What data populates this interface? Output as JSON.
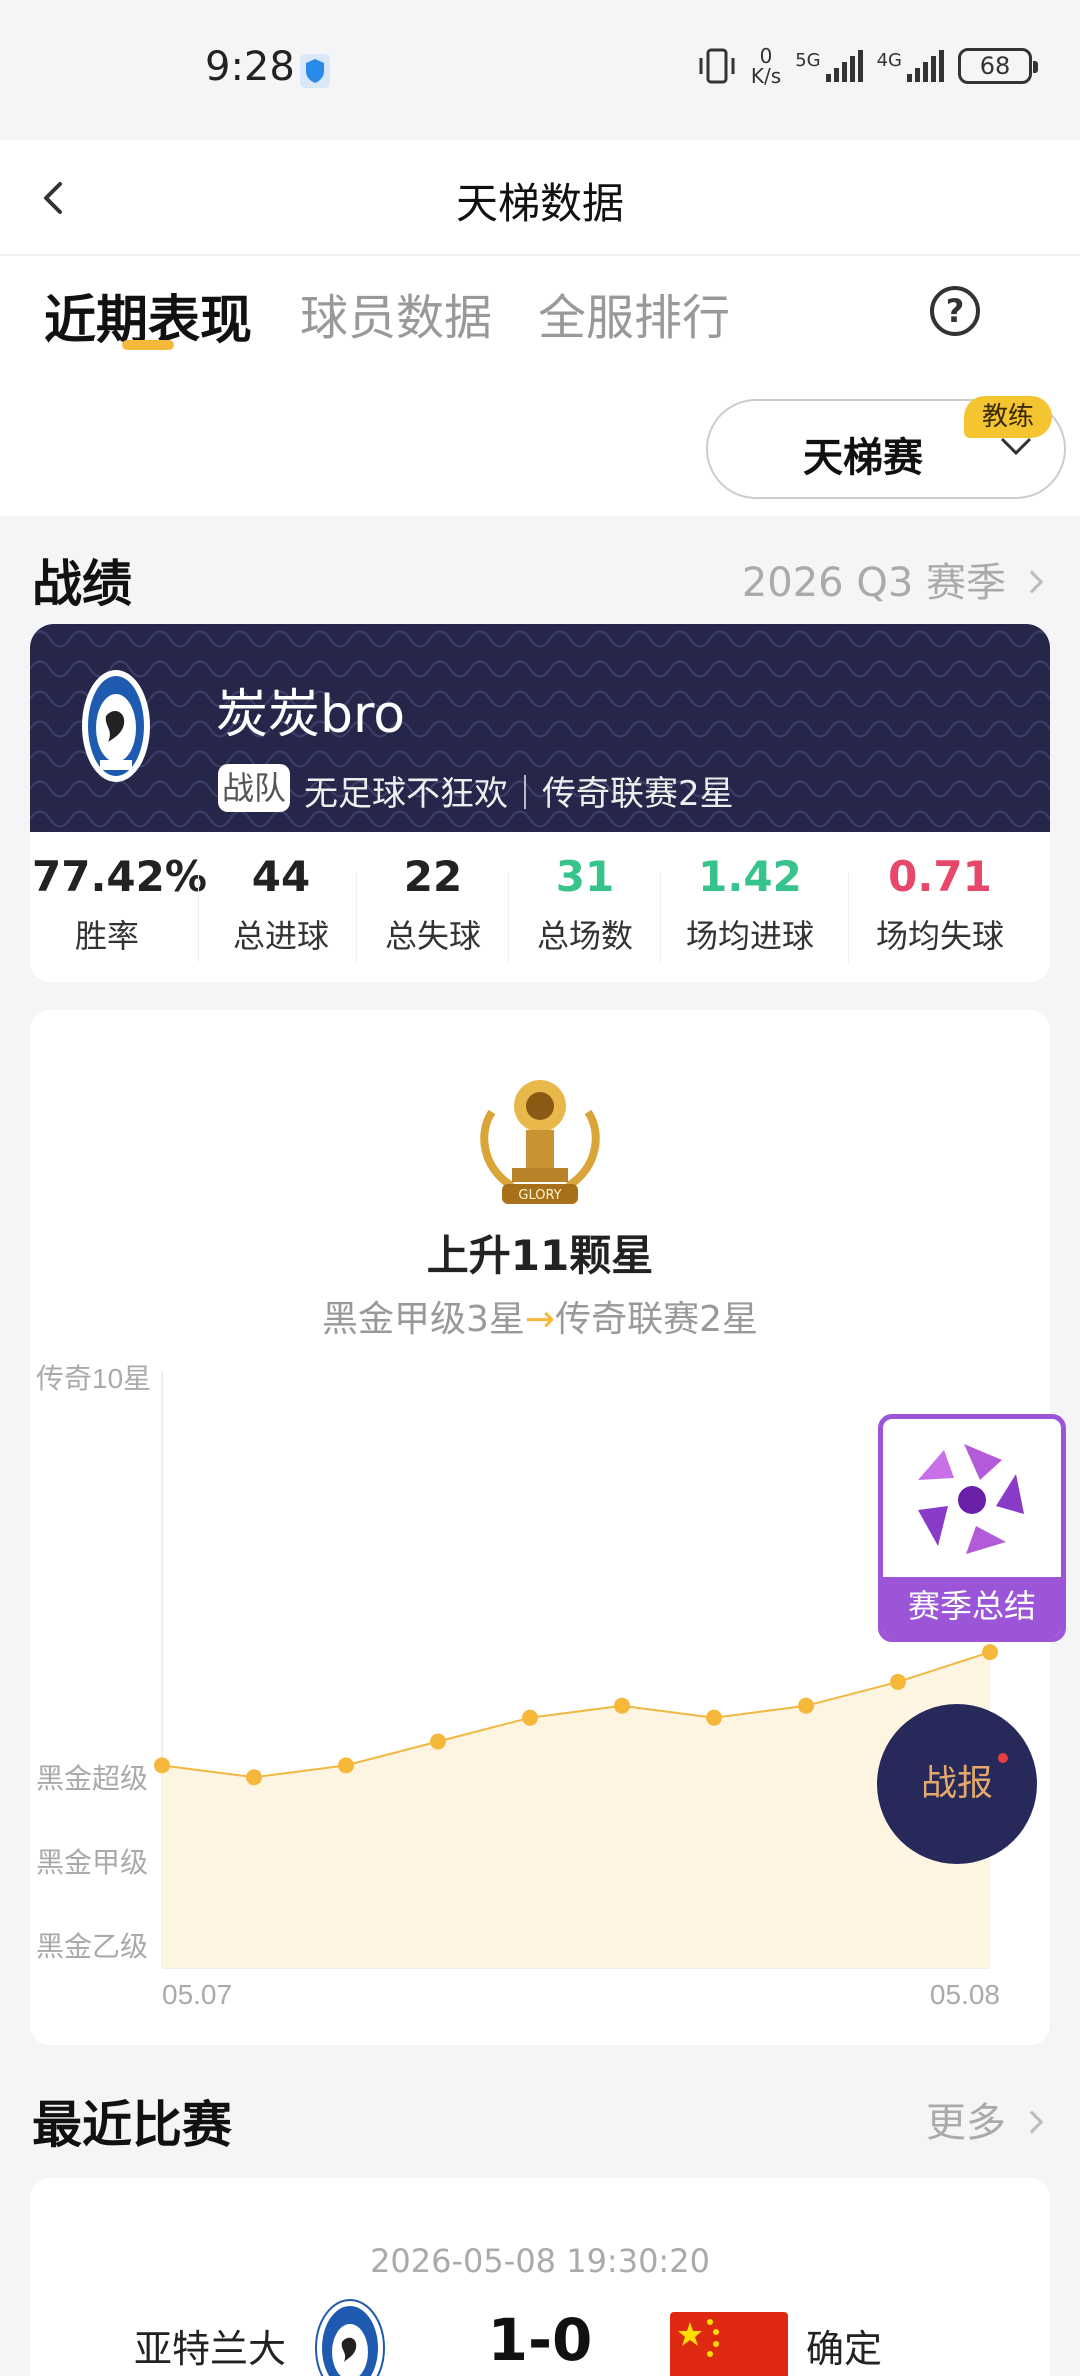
{
  "status_bar": {
    "time": "9:28",
    "net_speed_value": "0",
    "net_speed_unit": "K/s",
    "signal1": "5G",
    "signal2": "4G",
    "battery": "68"
  },
  "header": {
    "title": "天梯数据"
  },
  "tabs": [
    {
      "label": "近期表现",
      "active": true
    },
    {
      "label": "球员数据",
      "active": false
    },
    {
      "label": "全服排行",
      "active": false
    }
  ],
  "mode_select": {
    "label": "天梯赛",
    "badge": "教练"
  },
  "record": {
    "title": "战绩",
    "season": "2026 Q3 赛季",
    "team_name": "炭炭bro",
    "team_tag": "战队",
    "team_sub": "无足球不狂欢｜传奇联赛2星",
    "stats": [
      {
        "value": "77.42%",
        "label": "胜率",
        "color": "#222222"
      },
      {
        "value": "44",
        "label": "总进球",
        "color": "#222222"
      },
      {
        "value": "22",
        "label": "总失球",
        "color": "#222222"
      },
      {
        "value": "31",
        "label": "总场数",
        "color": "#37c38c"
      },
      {
        "value": "1.42",
        "label": "场均进球",
        "color": "#37c38c"
      },
      {
        "value": "0.71",
        "label": "场均失球",
        "color": "#e8476c"
      }
    ]
  },
  "progress": {
    "rise_text": "上升11颗星",
    "from_rank": "黑金甲级3星",
    "to_rank": "传奇联赛2星"
  },
  "chart_data": {
    "type": "line",
    "y_tick_labels": [
      "传奇10星",
      "黑金超级",
      "黑金甲级",
      "黑金乙级"
    ],
    "x_tick_labels": [
      "05.07",
      "05.08"
    ],
    "values": [
      3.4,
      3.2,
      3.4,
      3.8,
      4.2,
      4.4,
      4.2,
      4.4,
      4.8,
      5.3
    ],
    "ylim": [
      0,
      10
    ],
    "grid": false,
    "accent_color": "#f5b83a"
  },
  "floating": {
    "season_summary": "赛季总结",
    "report": "战报"
  },
  "recent": {
    "title": "最近比赛",
    "more": "更多",
    "match": {
      "time": "2026-05-08 19:30:20",
      "home": "亚特兰大",
      "score": "1-0",
      "away": "确定"
    }
  }
}
